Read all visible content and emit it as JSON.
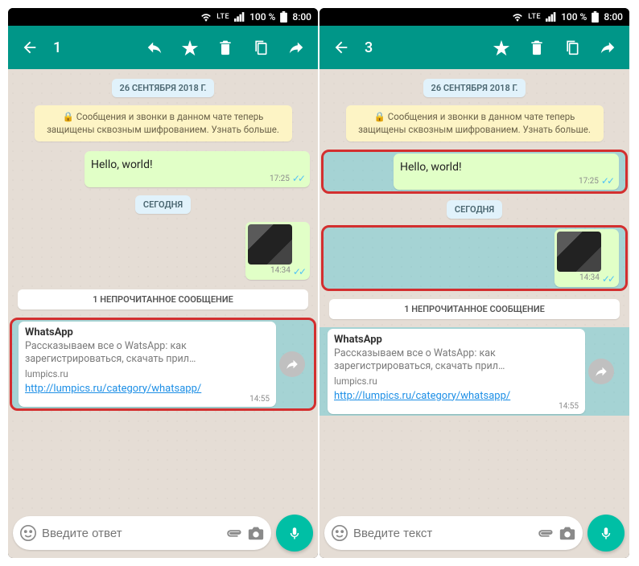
{
  "left": {
    "status": {
      "network": "LTE",
      "battery": "100 %",
      "time": "8:00"
    },
    "appbar": {
      "count": "1"
    },
    "date": "26 СЕНТЯБРЯ 2018 Г.",
    "encryption": "🔒 Сообщения и звонки в данном чате теперь защищены сквозным шифрованием. Узнать больше.",
    "msg1": {
      "text": "Hello, world!",
      "time": "17:25"
    },
    "today": "СЕГОДНЯ",
    "msg2_time": "14:34",
    "unread": "1 НЕПРОЧИТАННОЕ СООБЩЕНИЕ",
    "link": {
      "title": "WhatsApp",
      "desc": "Рассказываем все о WatsApp: как зарегистрироваться, скачать прил…",
      "domain": "lumpics.ru",
      "url": "http://lumpics.ru/category/whatsapp/",
      "time": "14:55"
    },
    "input_placeholder": "Введите ответ"
  },
  "right": {
    "status": {
      "network": "LTE",
      "battery": "100 %",
      "time": "8:00"
    },
    "appbar": {
      "count": "3"
    },
    "date": "26 СЕНТЯБРЯ 2018 Г.",
    "encryption": "🔒 Сообщения и звонки в данном чате теперь защищены сквозным шифрованием. Узнать больше.",
    "msg1": {
      "text": "Hello, world!",
      "time": "17:25"
    },
    "today": "СЕГОДНЯ",
    "msg2_time": "14:34",
    "unread": "1 НЕПРОЧИТАННОЕ СООБЩЕНИЕ",
    "link": {
      "title": "WhatsApp",
      "desc": "Рассказываем все о WatsApp: как зарегистрироваться, скачать прил…",
      "domain": "lumpics.ru",
      "url": "http://lumpics.ru/category/whatsapp/",
      "time": "14:55"
    },
    "input_placeholder": "Введите текст"
  }
}
